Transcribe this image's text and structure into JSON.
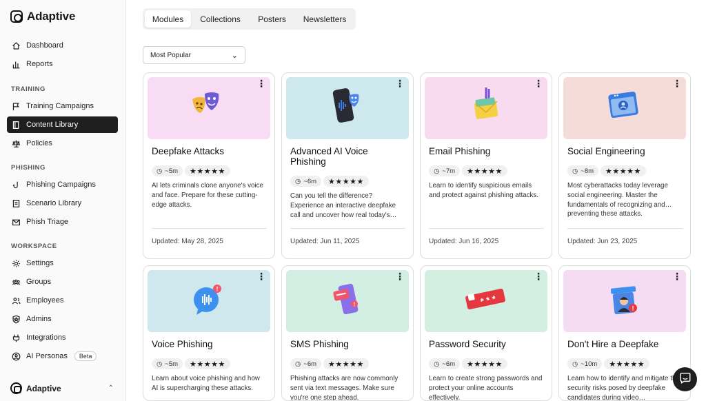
{
  "brand": {
    "name": "Adaptive"
  },
  "nav": {
    "top": [
      {
        "label": "Dashboard",
        "icon": "home-icon"
      },
      {
        "label": "Reports",
        "icon": "bar-chart-icon"
      }
    ],
    "training_label": "TRAINING",
    "training": [
      {
        "label": "Training Campaigns",
        "icon": "flag-icon"
      },
      {
        "label": "Content Library",
        "icon": "book-icon",
        "active": true
      },
      {
        "label": "Policies",
        "icon": "scale-icon"
      }
    ],
    "phishing_label": "PHISHING",
    "phishing": [
      {
        "label": "Phishing Campaigns",
        "icon": "hook-icon"
      },
      {
        "label": "Scenario Library",
        "icon": "document-icon"
      },
      {
        "label": "Phish Triage",
        "icon": "mail-icon"
      }
    ],
    "workspace_label": "WORKSPACE",
    "workspace": [
      {
        "label": "Settings",
        "icon": "gear-icon"
      },
      {
        "label": "Groups",
        "icon": "group-icon"
      },
      {
        "label": "Employees",
        "icon": "users-icon"
      },
      {
        "label": "Admins",
        "icon": "shield-icon"
      },
      {
        "label": "Integrations",
        "icon": "plug-icon"
      },
      {
        "label": "AI Personas",
        "icon": "persona-icon",
        "badge": "Beta"
      }
    ]
  },
  "footer": {
    "org_name": "Adaptive"
  },
  "tabs": [
    "Modules",
    "Collections",
    "Posters",
    "Newsletters"
  ],
  "sort": {
    "selected": "Most Popular"
  },
  "rating_stars": "★★★★★",
  "cards": [
    {
      "title": "Deepfake Attacks",
      "duration": "~5m",
      "desc": "AI lets criminals clone anyone's voice and face. Prepare for these cutting-edge attacks.",
      "updated": "Updated: May 28, 2025",
      "bg": "#f7dcf3",
      "icon": "theater-masks-icon"
    },
    {
      "title": "Advanced AI Voice Phishing",
      "duration": "~6m",
      "desc": "Can you tell the difference? Experience an interactive deepfake call and uncover how real today's…",
      "updated": "Updated: Jun 11, 2025",
      "bg": "#cde9ee",
      "icon": "phone-mask-icon"
    },
    {
      "title": "Email Phishing",
      "duration": "~7m",
      "desc": "Learn to identify suspicious emails and protect against phishing attacks.",
      "updated": "Updated: Jun 16, 2025",
      "bg": "#f9dbef",
      "icon": "envelope-hook-icon"
    },
    {
      "title": "Social Engineering",
      "duration": "~8m",
      "desc": "Most cyberattacks today leverage social engineering. Master the fundamentals of recognizing and… preventing these attacks.",
      "updated": "Updated: Jun 23, 2025",
      "bg": "#f6dcd8",
      "icon": "browser-user-icon"
    },
    {
      "title": "Voice Phishing",
      "duration": "~5m",
      "desc": "Learn about voice phishing and how AI is supercharging these attacks.",
      "updated": "",
      "bg": "#cfe8ee",
      "icon": "voice-bubble-icon"
    },
    {
      "title": "SMS Phishing",
      "duration": "~6m",
      "desc": "Phishing attacks are now commonly sent via text messages. Make sure you're one step ahead.",
      "updated": "",
      "bg": "#d3efe4",
      "icon": "sms-phone-icon"
    },
    {
      "title": "Password Security",
      "duration": "~6m",
      "desc": "Learn to create strong passwords and protect your online accounts effectively.",
      "updated": "",
      "bg": "#d3efe2",
      "icon": "password-field-icon"
    },
    {
      "title": "Don't Hire a Deepfake",
      "duration": "~10m",
      "desc": "Learn how to identify and mitigate the security risks posed by deepfake candidates during video…",
      "updated": "",
      "bg": "#f5dcf3",
      "icon": "fake-candidate-icon"
    }
  ]
}
